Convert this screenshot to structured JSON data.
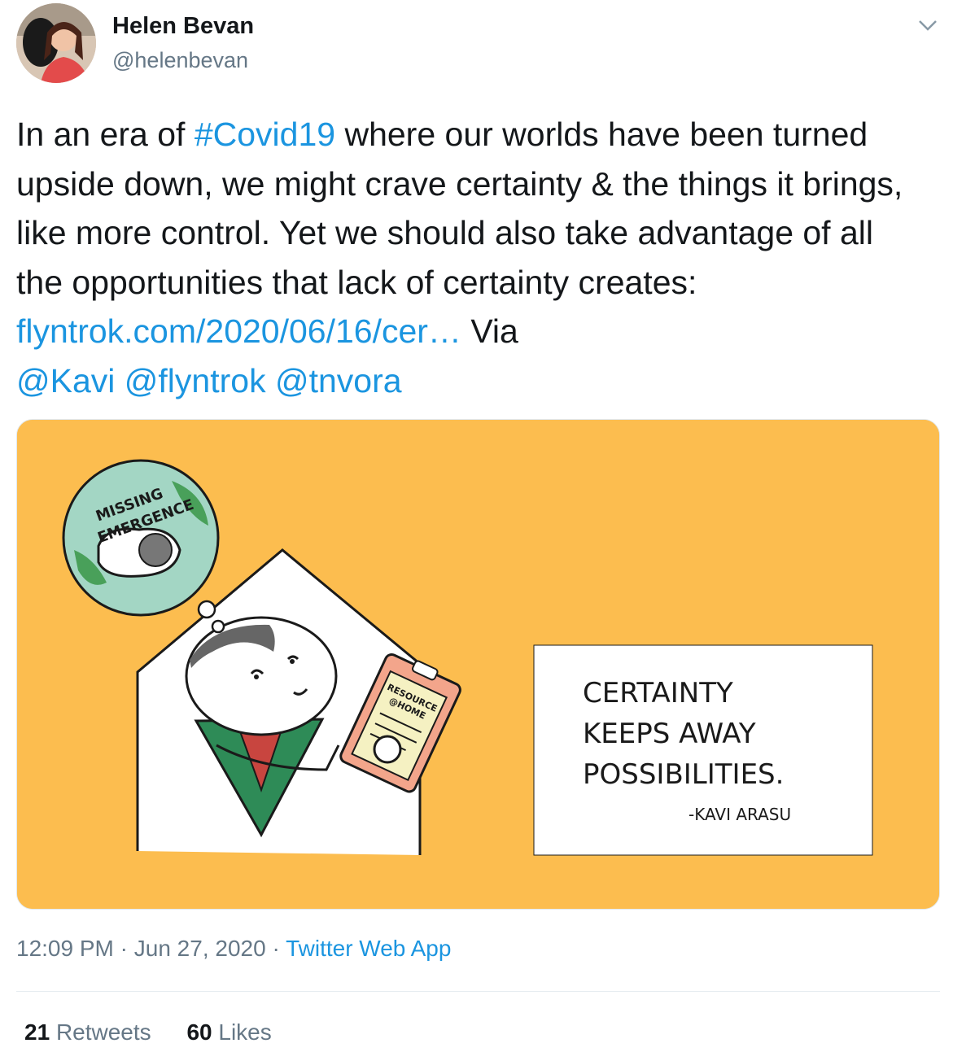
{
  "user": {
    "name": "Helen Bevan",
    "handle": "@helenbevan"
  },
  "tweet": {
    "text_1": "In an era of ",
    "hashtag": "#Covid19",
    "text_2": " where our worlds have been turned upside down, we might crave certainty & the things it brings, like more control. Yet we should also take advantage of all the opportunities that lack of certainty creates: ",
    "link": "flyntrok.com/2020/06/16/cer…",
    "text_3": " Via ",
    "mention_1": "@Kavi",
    "mention_2": "@flyntrok",
    "mention_3": "@tnvora"
  },
  "image": {
    "badge_line_1": "MISSING",
    "badge_line_2": "EMERGENCE",
    "clipboard_line_1": "RESOURCE",
    "clipboard_line_2": "@HOME",
    "quote_line_1": "CERTAINTY",
    "quote_line_2": "KEEPS AWAY",
    "quote_line_3": "POSSIBILITIES.",
    "quote_author": "-KAVI ARASU",
    "background_color": "#fcbd4f"
  },
  "meta": {
    "time": "12:09 PM",
    "separator": " · ",
    "date": "Jun 27, 2020",
    "source": "Twitter Web App"
  },
  "stats": {
    "retweets_count": "21",
    "retweets_label": "Retweets",
    "likes_count": "60",
    "likes_label": "Likes"
  },
  "colors": {
    "link": "#1b95e0",
    "secondary_text": "#657786"
  },
  "icons": {
    "caret": "chevron-down-icon"
  }
}
